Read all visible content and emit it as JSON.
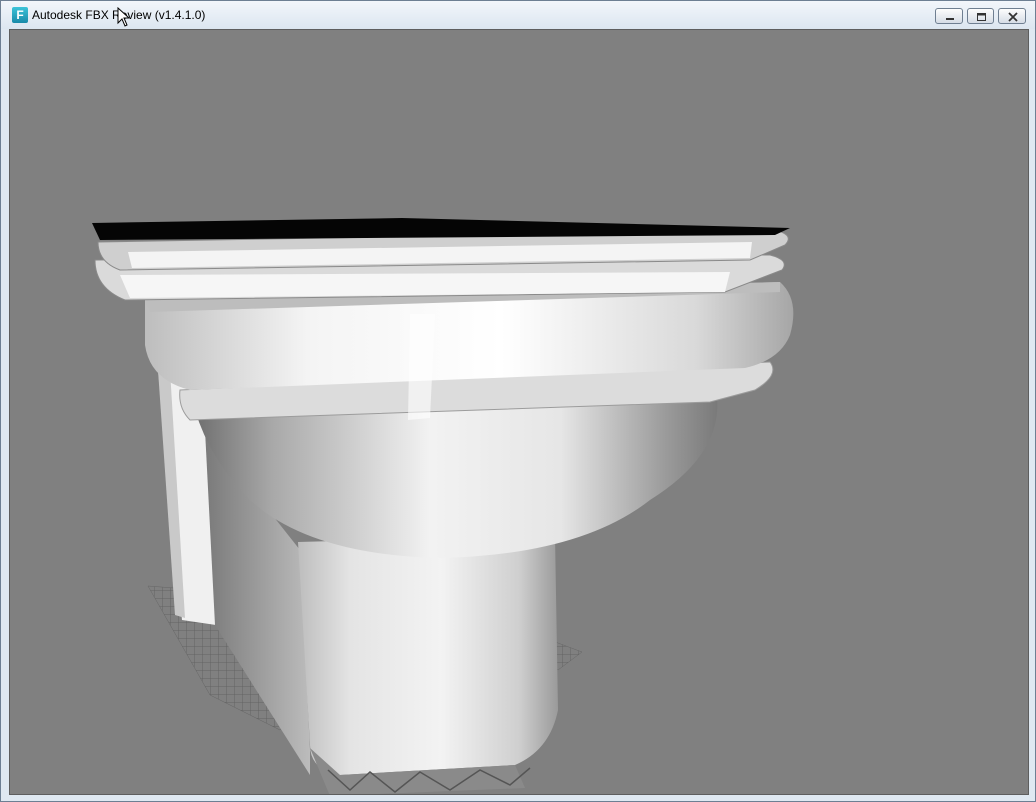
{
  "window": {
    "title": "Autodesk FBX Review (v1.4.1.0)",
    "app_icon_letter": "F",
    "icon": "fbx-review-app-icon"
  },
  "controls": {
    "minimize": "minimize-icon",
    "maximize": "maximize-icon",
    "close": "close-icon"
  },
  "viewport": {
    "background_color": "#808080",
    "model": "toilet-3d-model",
    "floor_grid": "ground-grid"
  }
}
